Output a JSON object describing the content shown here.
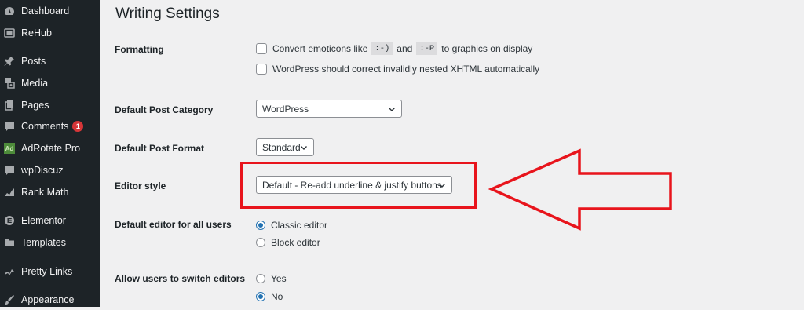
{
  "sidebar": {
    "items": [
      {
        "label": "Dashboard",
        "icon": "dashboard-icon"
      },
      {
        "label": "ReHub",
        "icon": "rehub-icon"
      },
      {
        "label": "Posts",
        "icon": "pin-icon"
      },
      {
        "label": "Media",
        "icon": "media-icon"
      },
      {
        "label": "Pages",
        "icon": "pages-icon"
      },
      {
        "label": "Comments",
        "icon": "comment-icon",
        "badge": "1"
      },
      {
        "label": "AdRotate Pro",
        "icon": "adrotate-icon",
        "icon_text": "Ad"
      },
      {
        "label": "wpDiscuz",
        "icon": "comment-icon"
      },
      {
        "label": "Rank Math",
        "icon": "chart-icon"
      },
      {
        "label": "Elementor",
        "icon": "elementor-icon"
      },
      {
        "label": "Templates",
        "icon": "folder-icon"
      },
      {
        "label": "Pretty Links",
        "icon": "star-link-icon"
      },
      {
        "label": "Appearance",
        "icon": "brush-icon"
      }
    ]
  },
  "page": {
    "title": "Writing Settings",
    "formatting": {
      "label": "Formatting",
      "emoticons_prefix": "Convert emoticons like",
      "code1": ":-)",
      "and": "and",
      "code2": ":-P",
      "emoticons_suffix": "to graphics on display",
      "xhtml": "WordPress should correct invalidly nested XHTML automatically"
    },
    "default_post_category": {
      "label": "Default Post Category",
      "value": "WordPress"
    },
    "default_post_format": {
      "label": "Default Post Format",
      "value": "Standard"
    },
    "editor_style": {
      "label": "Editor style",
      "value": "Default - Re-add underline & justify buttons"
    },
    "default_editor": {
      "label": "Default editor for all users",
      "options": [
        {
          "label": "Classic editor",
          "checked": true
        },
        {
          "label": "Block editor",
          "checked": false
        }
      ]
    },
    "allow_switch": {
      "label": "Allow users to switch editors",
      "options": [
        {
          "label": "Yes",
          "checked": false
        },
        {
          "label": "No",
          "checked": true
        }
      ]
    }
  },
  "colors": {
    "sidebar_bg": "#1d2327",
    "accent": "#2271b1",
    "badge": "#d63638",
    "annotation": "#e8141c"
  }
}
